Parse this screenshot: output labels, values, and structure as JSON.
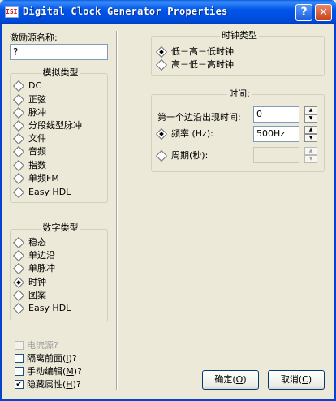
{
  "window": {
    "title": "Digital Clock Generator Properties",
    "icon_label": "ISIS",
    "help_button": "?",
    "close_button": "✕"
  },
  "left": {
    "source_name_label": "激励源名称:",
    "source_name_value": "?",
    "analog_group": {
      "legend": "模拟类型",
      "options": [
        "DC",
        "正弦",
        "脉冲",
        "分段线型脉冲",
        "文件",
        "音频",
        "指数",
        "单频FM",
        "Easy HDL"
      ]
    },
    "digital_group": {
      "legend": "数字类型",
      "options": [
        "稳态",
        "单边沿",
        "单脉冲",
        "时钟",
        "图案",
        "Easy HDL"
      ],
      "selected": "时钟"
    },
    "checks": {
      "current_source": "电流源?",
      "isolate_front_pre": "隔离前面(",
      "isolate_front_key": "I",
      "isolate_front_post": ")?",
      "manual_edit_pre": "手动编辑(",
      "manual_edit_key": "M",
      "manual_edit_post": ")?",
      "hide_props_pre": "隐藏属性(",
      "hide_props_key": "H",
      "hide_props_post": ")?"
    }
  },
  "right": {
    "clock_type": {
      "legend": "时钟类型",
      "option1": "低－高－低时钟",
      "option2": "高－低－高时钟",
      "selected": "低－高－低时钟"
    },
    "timing": {
      "legend": "时间:",
      "first_edge_label": "第一个边沿出现时间:",
      "first_edge_value": "0",
      "freq_label": "频率 (Hz):",
      "freq_value": "500Hz",
      "period_label": "周期(秒):",
      "period_value": ""
    }
  },
  "buttons": {
    "ok_pre": "确定(",
    "ok_key": "O",
    "ok_post": ")",
    "cancel_pre": "取消(",
    "cancel_key": "C",
    "cancel_post": ")"
  },
  "spin_glyphs": {
    "up": "▲",
    "down": "▼"
  }
}
